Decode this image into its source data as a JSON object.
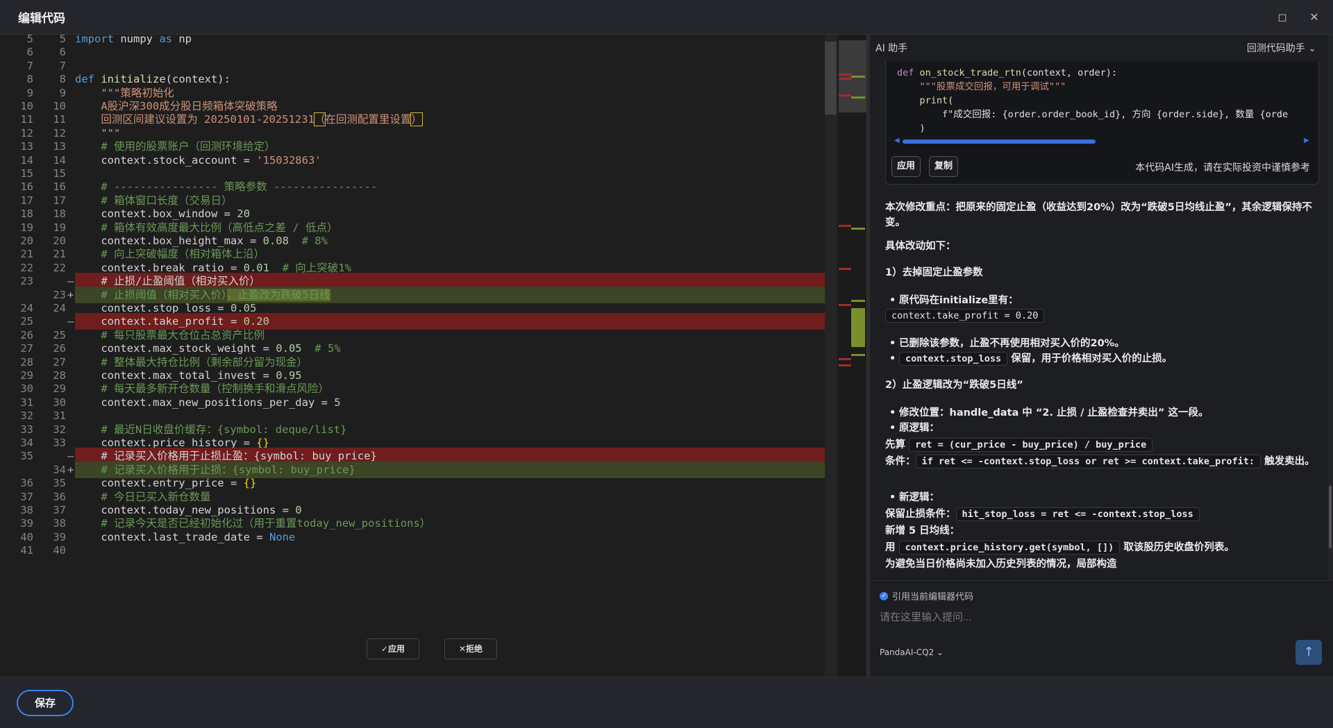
{
  "window": {
    "title": "编辑代码",
    "maximize_icon": "maximize-icon",
    "close_icon": "close-icon"
  },
  "editor": {
    "lines": [
      {
        "a": "5",
        "b": "5",
        "t": "normal",
        "k": "import"
      },
      {
        "a": "6",
        "b": "6",
        "t": "normal",
        "k": "blank"
      },
      {
        "a": "7",
        "b": "7",
        "t": "normal",
        "k": "blank"
      },
      {
        "a": "8",
        "b": "8",
        "t": "normal",
        "k": "def"
      },
      {
        "a": "9",
        "b": "9",
        "t": "normal",
        "k": "doc1"
      },
      {
        "a": "10",
        "b": "10",
        "t": "normal",
        "k": "doc2"
      },
      {
        "a": "11",
        "b": "11",
        "t": "normal",
        "k": "doc3"
      },
      {
        "a": "12",
        "b": "12",
        "t": "normal",
        "k": "doc4"
      },
      {
        "a": "13",
        "b": "13",
        "t": "normal",
        "k": "c1"
      },
      {
        "a": "14",
        "b": "14",
        "t": "normal",
        "k": "acct"
      },
      {
        "a": "15",
        "b": "15",
        "t": "normal",
        "k": "blank"
      },
      {
        "a": "16",
        "b": "16",
        "t": "normal",
        "k": "c2"
      },
      {
        "a": "17",
        "b": "17",
        "t": "normal",
        "k": "c3"
      },
      {
        "a": "18",
        "b": "18",
        "t": "normal",
        "k": "bw"
      },
      {
        "a": "19",
        "b": "19",
        "t": "normal",
        "k": "c4"
      },
      {
        "a": "20",
        "b": "20",
        "t": "normal",
        "k": "bh"
      },
      {
        "a": "21",
        "b": "21",
        "t": "normal",
        "k": "c5"
      },
      {
        "a": "22",
        "b": "22",
        "t": "normal",
        "k": "br"
      },
      {
        "a": "23",
        "b": "",
        "t": "del",
        "k": "d1"
      },
      {
        "a": "",
        "b": "23",
        "t": "add",
        "k": "a1"
      },
      {
        "a": "24",
        "b": "24",
        "t": "normal",
        "k": "sl"
      },
      {
        "a": "25",
        "b": "",
        "t": "del",
        "k": "tp"
      },
      {
        "a": "26",
        "b": "25",
        "t": "normal",
        "k": "c6"
      },
      {
        "a": "27",
        "b": "26",
        "t": "normal",
        "k": "msw"
      },
      {
        "a": "28",
        "b": "27",
        "t": "normal",
        "k": "c7"
      },
      {
        "a": "29",
        "b": "28",
        "t": "normal",
        "k": "mti"
      },
      {
        "a": "30",
        "b": "29",
        "t": "normal",
        "k": "c8"
      },
      {
        "a": "31",
        "b": "30",
        "t": "normal",
        "k": "mnp"
      },
      {
        "a": "32",
        "b": "31",
        "t": "normal",
        "k": "blank"
      },
      {
        "a": "33",
        "b": "32",
        "t": "normal",
        "k": "c9"
      },
      {
        "a": "34",
        "b": "33",
        "t": "normal",
        "k": "ph"
      },
      {
        "a": "35",
        "b": "",
        "t": "del",
        "k": "d2"
      },
      {
        "a": "",
        "b": "34",
        "t": "add",
        "k": "a2"
      },
      {
        "a": "36",
        "b": "35",
        "t": "normal",
        "k": "ep"
      },
      {
        "a": "37",
        "b": "36",
        "t": "normal",
        "k": "c10"
      },
      {
        "a": "38",
        "b": "37",
        "t": "normal",
        "k": "tnp"
      },
      {
        "a": "39",
        "b": "38",
        "t": "normal",
        "k": "c11"
      },
      {
        "a": "40",
        "b": "39",
        "t": "normal",
        "k": "ltd"
      },
      {
        "a": "41",
        "b": "40",
        "t": "normal",
        "k": "blank"
      }
    ],
    "text": {
      "import_kw": "import",
      "import_mod": " numpy ",
      "import_as": "as",
      "import_alias": " np",
      "def_kw": "def",
      "def_fn": " initialize",
      "def_args": "(context):",
      "doc1": "    \"\"\"策略初始化",
      "doc2": "    A股沪深300成分股日频箱体突破策略",
      "doc3_a": "    回测区间建议设置为 20250101-20251231",
      "doc3_b": "（",
      "doc3_c": "在回测配置里设置",
      "doc3_d": "）",
      "doc4": "    \"\"\"",
      "c1": "    # 使用的股票账户（回测环境给定）",
      "acct_a": "    context.stock_account = ",
      "acct_b": "'15032863'",
      "c2": "    # ---------------- 策略参数 ----------------",
      "c3": "    # 箱体窗口长度（交易日）",
      "bw_a": "    context.box_window = ",
      "bw_b": "20",
      "c4": "    # 箱体有效高度最大比例（高低点之差 / 低点）",
      "bh_a": "    context.box_height_max = ",
      "bh_b": "0.08",
      "bh_c": "  # 8%",
      "c5": "    # 向上突破幅度（相对箱体上沿）",
      "br_a": "    context.break_ratio = ",
      "br_b": "0.01",
      "br_c": "  # 向上突破1%",
      "d1": "    # 止损/止盈阈值（相对买入价）",
      "a1_a": "    # 止损阈值（相对买入价）",
      "a1_b": "，止盈改为跌破5日线",
      "sl_a": "    context.stop_loss = ",
      "sl_b": "0.05",
      "tp_a": "    context.take_profit = ",
      "tp_b": "0.20",
      "c6": "    # 每只股票最大仓位占总资产比例",
      "msw_a": "    context.max_stock_weight = ",
      "msw_b": "0.05",
      "msw_c": "  # 5%",
      "c7": "    # 整体最大持仓比例（剩余部分留为现金）",
      "mti_a": "    context.max_total_invest = ",
      "mti_b": "0.95",
      "c8": "    # 每天最多新开仓数量（控制换手和滑点风险）",
      "mnp_a": "    context.max_new_positions_per_day = ",
      "mnp_b": "5",
      "c9": "    # 最近N日收盘价缓存：{symbol: deque/list}",
      "ph_a": "    context.price_history = ",
      "ph_b": "{}",
      "d2": "    # 记录买入价格用于止损止盈：{symbol: buy_price}",
      "a2": "    # 记录买入价格用于止损：{symbol: buy_price}",
      "ep_a": "    context.entry_price = ",
      "ep_b": "{}",
      "c10": "    # 今日已买入新仓数量",
      "tnp_a": "    context.today_new_positions = ",
      "tnp_b": "0",
      "c11": "    # 记录今天是否已经初始化过（用于重置today_new_positions）",
      "ltd_a": "    context.last_trade_date = ",
      "ltd_b": "None"
    },
    "apply_label": "✓应用",
    "reject_label": "✕拒绝"
  },
  "assistant": {
    "title": "AI 助手",
    "mode_label": "回测代码助手",
    "code_lines": {
      "l1_kw": "def",
      "l1_fn": " on_stock_trade_rtn",
      "l1_rest": "(context, order):",
      "l2": "    \"\"\"股票成交回报，可用于调试\"\"\"",
      "l3_fn": "    print",
      "l3_rest": "(",
      "l4": "        f\"成交回报: {order.order_book_id}, 方向 {order.side}, 数量 {orde",
      "l5": "    )"
    },
    "apply_btn": "应用",
    "copy_btn": "复制",
    "disclaimer": "本代码AI生成，请在实际投资中谨慎参考",
    "summary": "本次修改重点：把原来的固定止盈（收益达到20%）改为“跌破5日均线止盈”，其余逻辑保持不变。",
    "details_heading": "具体改动如下：",
    "step1": "1）去掉固定止盈参数",
    "b1": "原代码在initialize里有：",
    "b1_code": "context.take_profit = 0.20",
    "b2": "已删除该参数，止盈不再使用相对买入价的20%。",
    "b3_code": "context.stop_loss",
    "b3_rest": " 保留，用于价格相对买入价的止损。",
    "step2": "2）止盈逻辑改为“跌破5日线”",
    "b4": "修改位置：handle_data 中 “2. 止损 / 止盈检查并卖出” 这一段。",
    "b5": "原逻辑：",
    "p1_a": "先算 ",
    "p1_code": "ret = (cur_price - buy_price) / buy_price",
    "p2_a": "条件：",
    "p2_code": "if ret <= -context.stop_loss or ret >= context.take_profit:",
    "p2_b": " 触发卖出。",
    "b6": "新逻辑：",
    "p3_a": "保留止损条件：",
    "p3_code": "hit_stop_loss = ret <= -context.stop_loss",
    "p4": "新增 5 日均线：",
    "p5_a": "用 ",
    "p5_code": "context.price_history.get(symbol, [])",
    "p5_b": " 取该股历史收盘价列表。",
    "p6": "为避免当日价格尚未加入历史列表的情况，局部构造"
  },
  "input": {
    "ref_label": "引用当前编辑器代码",
    "placeholder": "请在这里输入提问...",
    "model": "PandaAI-CQ2",
    "send_icon": "send-arrow-icon"
  },
  "footer": {
    "save_label": "保存"
  }
}
